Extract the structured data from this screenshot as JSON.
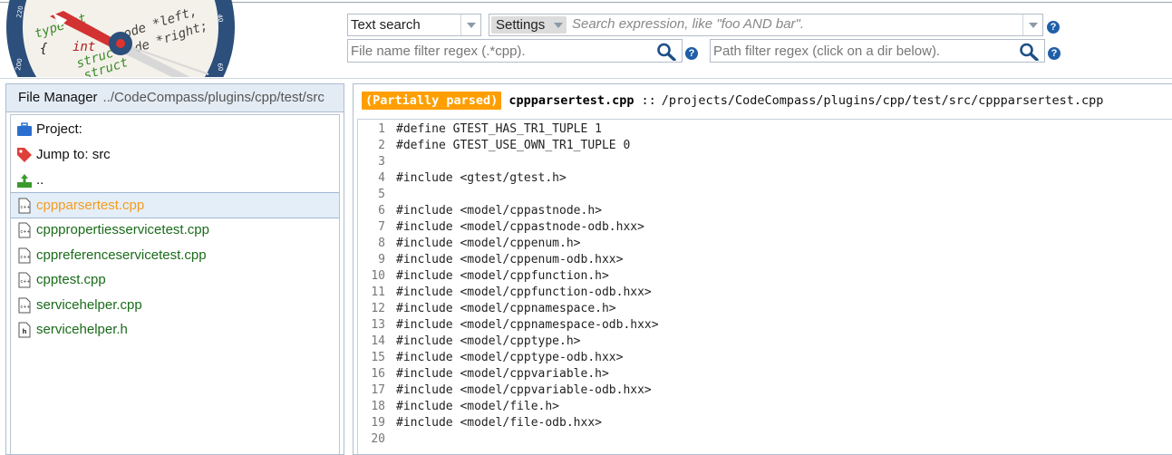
{
  "search": {
    "type_selected": "Text search",
    "settings_label": "Settings",
    "expression_placeholder": "Search expression, like \"foo AND bar\".",
    "filename_placeholder": "File name filter regex (.*cpp).",
    "path_placeholder": "Path filter regex (click on a dir below).",
    "help_glyph": "?"
  },
  "file_manager": {
    "title": "File Manager",
    "path": "../CodeCompass/plugins/cpp/test/src",
    "items": [
      {
        "label": "Project:",
        "icon": "briefcase-icon",
        "kind": "plain"
      },
      {
        "label": "Jump to: src",
        "icon": "tag-icon",
        "kind": "plain"
      },
      {
        "label": "..",
        "icon": "up-directory-icon",
        "kind": "plain"
      },
      {
        "label": "cppparsertest.cpp",
        "icon": "cpp-file-icon",
        "kind": "file",
        "selected": true
      },
      {
        "label": "cpppropertiesservicetest.cpp",
        "icon": "cpp-file-icon",
        "kind": "file"
      },
      {
        "label": "cppreferenceservicetest.cpp",
        "icon": "cpp-file-icon",
        "kind": "file"
      },
      {
        "label": "cpptest.cpp",
        "icon": "cpp-file-icon",
        "kind": "file"
      },
      {
        "label": "servicehelper.cpp",
        "icon": "cpp-file-icon",
        "kind": "file"
      },
      {
        "label": "servicehelper.h",
        "icon": "header-file-icon",
        "kind": "file"
      }
    ]
  },
  "editor": {
    "badge": "(Partially parsed)",
    "filename": "cppparsertest.cpp",
    "separator": "::",
    "path": "/projects/CodeCompass/plugins/cpp/test/src/cppparsertest.cpp",
    "lines": [
      "#define GTEST_HAS_TR1_TUPLE 1",
      "#define GTEST_USE_OWN_TR1_TUPLE 0",
      "",
      "#include <gtest/gtest.h>",
      "",
      "#include <model/cppastnode.h>",
      "#include <model/cppastnode-odb.hxx>",
      "#include <model/cppenum.h>",
      "#include <model/cppenum-odb.hxx>",
      "#include <model/cppfunction.h>",
      "#include <model/cppfunction-odb.hxx>",
      "#include <model/cppnamespace.h>",
      "#include <model/cppnamespace-odb.hxx>",
      "#include <model/cpptype.h>",
      "#include <model/cpptype-odb.hxx>",
      "#include <model/cppvariable.h>",
      "#include <model/cppvariable-odb.hxx>",
      "#include <model/file.h>",
      "#include <model/file-odb.hxx>",
      ""
    ]
  },
  "colors": {
    "badge": "#ff9e00",
    "file_link": "#1a6b1a",
    "selected_file": "#f39c1f",
    "help": "#1f5fa8",
    "logo_ring": "#2c4f7c"
  }
}
